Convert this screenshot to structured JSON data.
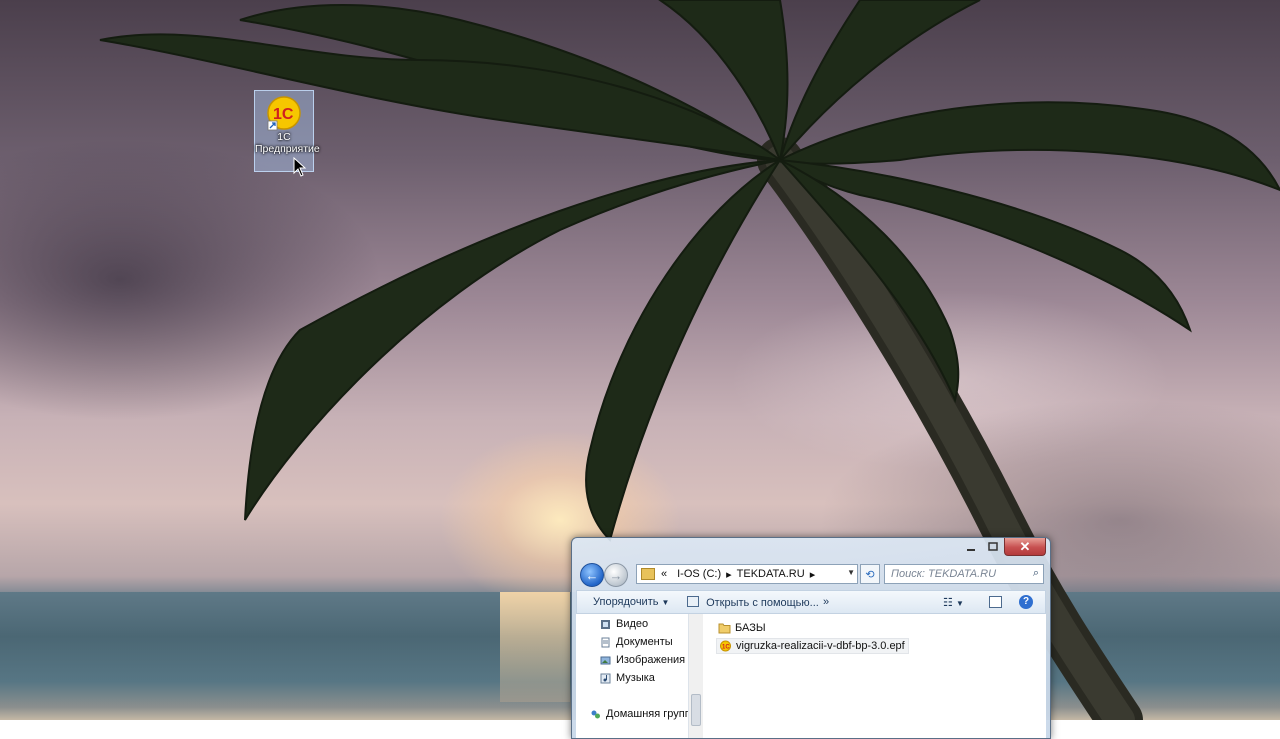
{
  "desktop": {
    "icon_label": "1С Предприятие"
  },
  "explorer": {
    "address": {
      "prefix": "«",
      "segments": [
        "I-OS (C:)",
        "TEKDATA.RU"
      ]
    },
    "search_placeholder": "Поиск: TEKDATA.RU",
    "toolbar": {
      "organize": "Упорядочить",
      "open_with": "Открыть с помощью...",
      "more": "»"
    },
    "nav_items": [
      {
        "label": "Видео",
        "icon": "video-icon"
      },
      {
        "label": "Документы",
        "icon": "documents-icon"
      },
      {
        "label": "Изображения",
        "icon": "pictures-icon"
      },
      {
        "label": "Музыка",
        "icon": "music-icon"
      },
      {
        "label": "Домашняя групп",
        "icon": "homegroup-icon"
      }
    ],
    "files": [
      {
        "name": "БАЗЫ",
        "icon": "folder-icon"
      },
      {
        "name": "vigruzka-realizacii-v-dbf-bp-3.0.epf",
        "icon": "epf-file-icon"
      }
    ]
  }
}
